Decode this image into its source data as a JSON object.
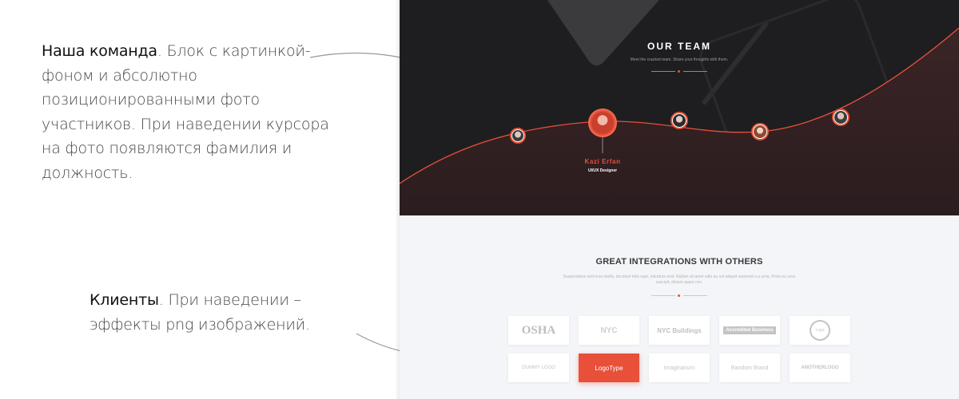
{
  "annotations": {
    "team": {
      "heading": "Наша команда",
      "text": ". Блок с картинкой-фоном и абсолютно позиционированными фото участников. При наведении курсора на фото появляются фамилия и должность."
    },
    "clients": {
      "heading": "Клиенты",
      "text": ". При наведении – эффекты png изображений."
    }
  },
  "team_section": {
    "title": "OUR TEAM",
    "subtitle": "Meet the craziest team. Share your thoughts with them.",
    "active_member": {
      "name": "Kazi Erfan",
      "role": "UI/UX Designer"
    }
  },
  "integrations": {
    "title": "GREAT INTEGRATIONS WITH OTHERS",
    "subtitle": "Suspendisse sed eros mollis, tincidunt felis eget, interdum erat. Nullam sit amet odio eu est aliquet euismod a a urna. Proin eu urna suscipit, dictum quam nec.",
    "logos": [
      "OSHA",
      "NYC",
      "NYC Buildings",
      "Accredited Business",
      "Logo",
      "DUMMY LOGO",
      "LogoType",
      "Imaginarium",
      "Random Brand",
      "ANOTHERLOGO"
    ]
  },
  "colors": {
    "accent": "#e8503a",
    "dark": "#1e1e20",
    "light_bg": "#f4f5f8"
  }
}
